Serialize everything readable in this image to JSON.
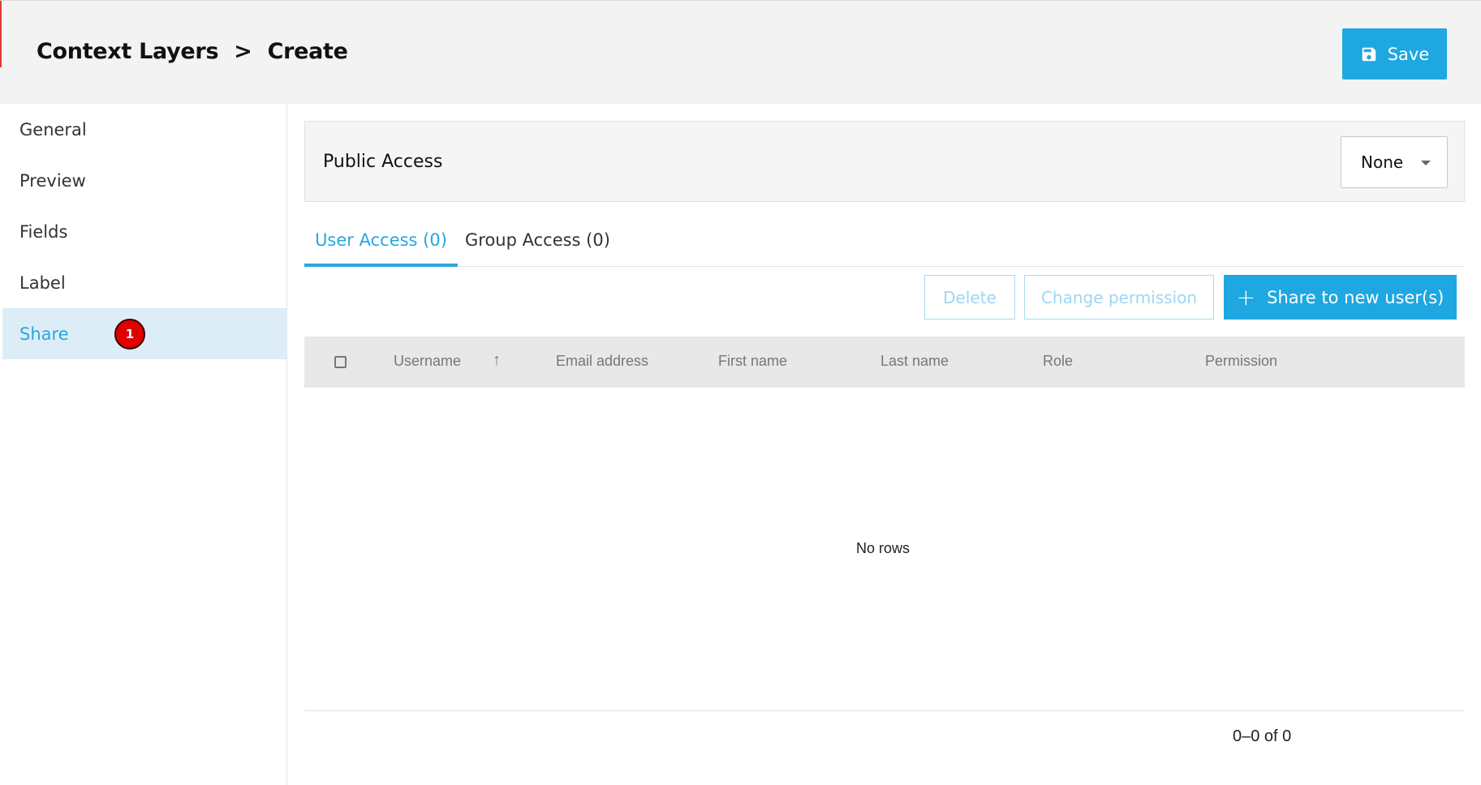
{
  "header": {
    "breadcrumb": [
      "Context Layers",
      ">",
      "Create"
    ],
    "save_label": "Save"
  },
  "sidebar": {
    "items": [
      {
        "label": "General"
      },
      {
        "label": "Preview"
      },
      {
        "label": "Fields"
      },
      {
        "label": "Label"
      },
      {
        "label": "Share",
        "badge": "1"
      }
    ],
    "active": "Share"
  },
  "public_access": {
    "label": "Public Access",
    "selected": "None"
  },
  "tabs": [
    {
      "label": "User Access (0)",
      "active": true
    },
    {
      "label": "Group Access (0)",
      "active": false
    }
  ],
  "actions": {
    "delete": "Delete",
    "change_permission": "Change permission",
    "share": "Share to new user(s)"
  },
  "table": {
    "columns": [
      "Username",
      "Email address",
      "First name",
      "Last name",
      "Role",
      "Permission"
    ],
    "empty_text": "No rows",
    "pagination": "0–0 of 0"
  },
  "colors": {
    "accent": "#1ea7e1",
    "active_bg": "#dcedf8",
    "badge": "#e00000"
  }
}
